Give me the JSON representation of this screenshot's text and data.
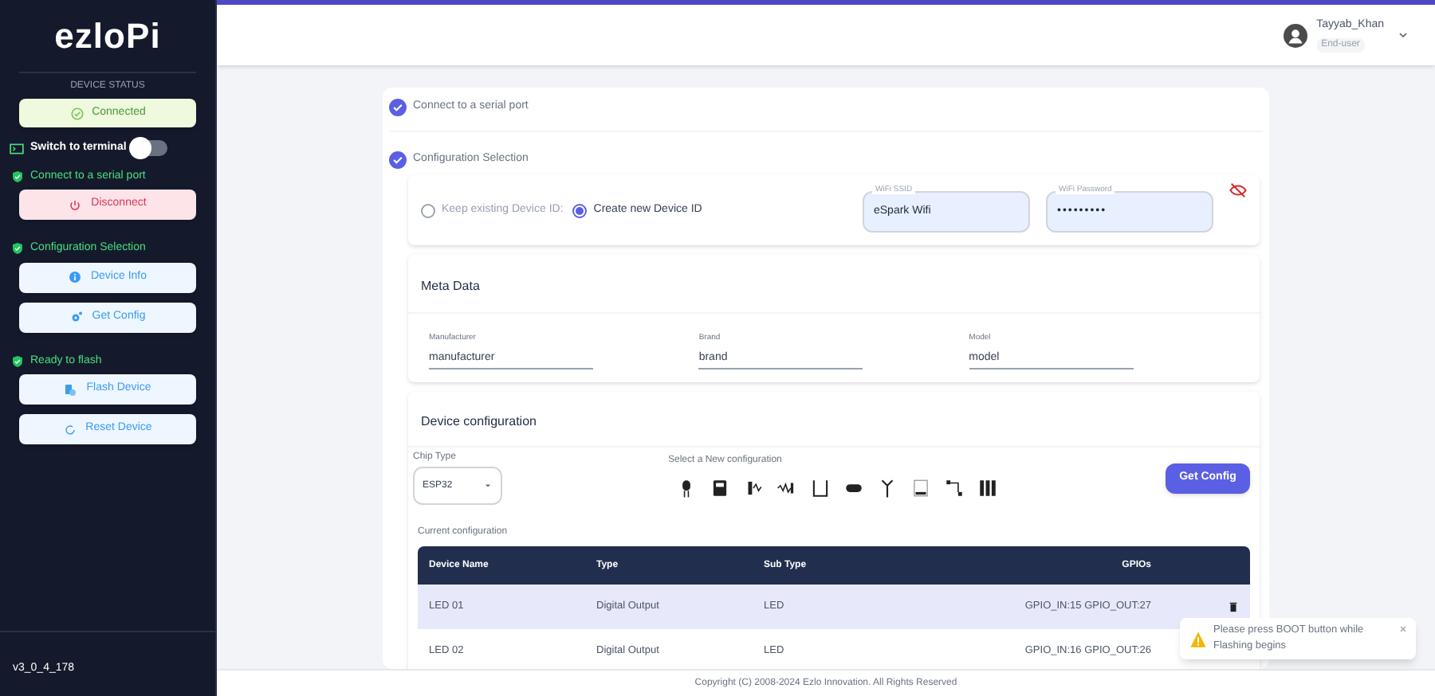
{
  "sidebar": {
    "logo": "ezloPi",
    "status_label": "DEVICE STATUS",
    "status_button": "Connected",
    "terminal": {
      "label": "Switch to terminal",
      "on": false
    },
    "sections": [
      {
        "title": "Connect to a serial port",
        "done": true,
        "buttons": [
          {
            "label": "Disconnect",
            "kind": "danger"
          }
        ]
      },
      {
        "title": "Configuration Selection",
        "done": true,
        "buttons": [
          {
            "label": "Device Info",
            "kind": "info"
          },
          {
            "label": "Get Config",
            "kind": "info"
          }
        ]
      },
      {
        "title": "Ready to flash",
        "done": true,
        "buttons": [
          {
            "label": "Flash Device",
            "kind": "info"
          },
          {
            "label": "Reset Device",
            "kind": "info"
          }
        ]
      }
    ],
    "version": "v3_0_4_178"
  },
  "user": {
    "name": "Tayyab_Khan",
    "role": "End-user"
  },
  "steps": [
    {
      "label": "Connect to a serial port",
      "done": true
    },
    {
      "label": "Configuration Selection",
      "done": true
    }
  ],
  "device_id": {
    "options": [
      {
        "label": "Keep existing Device ID:",
        "selected": false
      },
      {
        "label": "Create new Device ID",
        "selected": true
      }
    ],
    "wifi_ssid": {
      "label": "WiFi SSID",
      "value": "eSpark Wifi"
    },
    "wifi_password": {
      "label": "WiFi Password",
      "value": "•••••••••"
    }
  },
  "meta_data": {
    "title": "Meta Data",
    "fields": [
      {
        "label": "Manufacturer",
        "value": "manufacturer"
      },
      {
        "label": "Brand",
        "value": "brand"
      },
      {
        "label": "Model",
        "value": "model"
      }
    ]
  },
  "device_configuration": {
    "title": "Device configuration",
    "chip_type": {
      "label": "Chip Type",
      "value": "ESP32"
    },
    "new_config_label": "Select a New configuration",
    "get_config_button": "Get Config",
    "current_label": "Current configuration",
    "columns": [
      "Device Name",
      "Type",
      "Sub Type",
      "GPIOs"
    ],
    "rows": [
      {
        "cells": [
          "LED 01",
          "Digital Output",
          "LED",
          "GPIO_IN:15 GPIO_OUT:27"
        ],
        "selected": true
      },
      {
        "cells": [
          "LED 02",
          "Digital Output",
          "LED",
          "GPIO_IN:16 GPIO_OUT:26"
        ],
        "selected": false
      }
    ]
  },
  "toast": {
    "message": "Please press BOOT button while Flashing begins"
  },
  "footer": "Copyright (C) 2008-2024 Ezlo Innovation. All Rights Reserved"
}
